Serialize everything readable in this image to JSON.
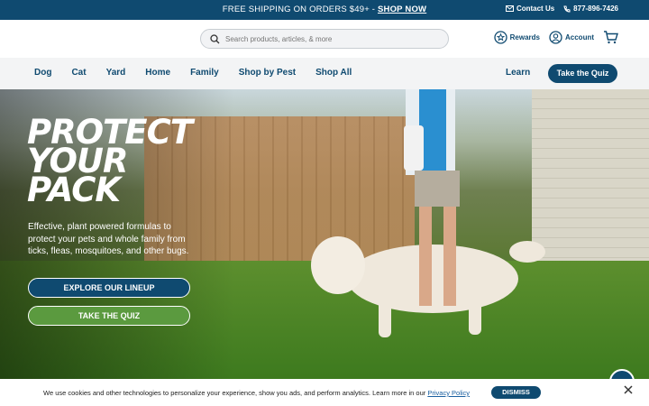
{
  "promo": {
    "text": "FREE SHIPPING ON ORDERS $49+ - ",
    "link": "SHOP NOW",
    "contact": "Contact Us",
    "phone": "877-896-7426"
  },
  "header": {
    "search_placeholder": "Search products, articles, & more",
    "rewards": "Rewards",
    "account": "Account"
  },
  "nav": {
    "items": [
      "Dog",
      "Cat",
      "Yard",
      "Home",
      "Family",
      "Shop by Pest",
      "Shop All"
    ],
    "learn": "Learn",
    "quiz": "Take the Quiz"
  },
  "hero": {
    "headline": [
      "PROTECT",
      "YOUR",
      "PACK"
    ],
    "subtext": "Effective, plant powered formulas to protect your pets and whole family from ticks, fleas, mosquitoes, and other bugs.",
    "cta_primary": "EXPLORE OUR LINEUP",
    "cta_secondary": "TAKE THE QUIZ"
  },
  "cookie": {
    "text": "We use cookies and other technologies to personalize your experience, show you ads, and perform analytics. Learn more in our ",
    "link": "Privacy Policy",
    "dismiss": "DISMISS"
  },
  "colors": {
    "brand": "#0f4a70",
    "green": "#5b9a3f"
  },
  "icons": [
    "mail-icon",
    "phone-icon",
    "search-icon",
    "rewards-star-icon",
    "account-icon",
    "cart-icon",
    "chat-icon",
    "close-icon"
  ]
}
